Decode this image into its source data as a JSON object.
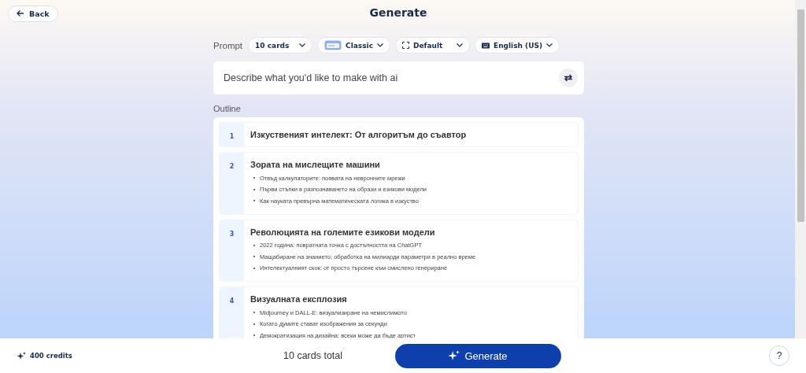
{
  "header": {
    "back": "Back",
    "title": "Generate"
  },
  "prompt": {
    "label": "Prompt",
    "options": [
      {
        "kind": "plain",
        "label": "10 cards"
      },
      {
        "kind": "theme",
        "label": "Classic"
      },
      {
        "kind": "layout",
        "label": "Default"
      },
      {
        "kind": "language",
        "label": "English (US)"
      }
    ],
    "placeholder": "Describe what you'd like to make with ai"
  },
  "outline": {
    "label": "Outline",
    "cards": [
      {
        "number": "1",
        "title": "Изкуственият интелект: От алгоритъм до съавтор"
      },
      {
        "number": "2",
        "title": "Зората на мислещите машини",
        "bullets": [
          "Отвъд калкулаторите: появата на невронните мрежи",
          "Първи стъпки в разпознаването на образи и езикови модели",
          "Как науката превърна математическата логика в изкуство"
        ]
      },
      {
        "number": "3",
        "title": "Революцията на големите езикови модели",
        "bullets": [
          "2022 година: повратната точка с достъпността на ChatGPT",
          "Мащабиране на знанието: обработка на милиарди параметри в реално време",
          "Интелектуалният скок: от просто търсене към смислено генериране"
        ]
      },
      {
        "number": "4",
        "title": "Визуалната експлозия",
        "bullets": [
          "Midjourney и DALL-E: визуализиране на немислимото",
          "Когато думите стават изображения за секунди",
          "Демократизация на дизайна: всеки може да бъде артист"
        ]
      }
    ]
  },
  "footer": {
    "credits": "400 credits",
    "total": "10 cards total",
    "generate": "Generate",
    "help": "?"
  }
}
